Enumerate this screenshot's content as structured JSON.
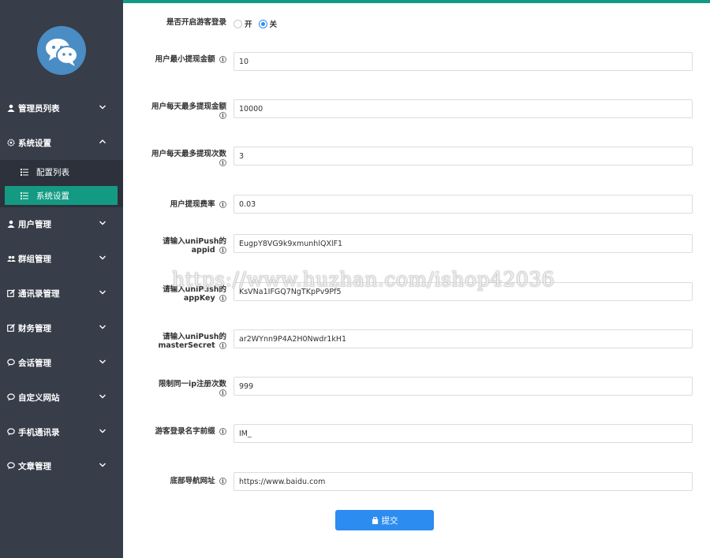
{
  "sidebar": {
    "items": [
      {
        "label": "管理员列表",
        "icon": "user-icon"
      },
      {
        "label": "系统设置",
        "icon": "gear-icon"
      },
      {
        "label": "用户管理",
        "icon": "user-icon"
      },
      {
        "label": "群组管理",
        "icon": "group-icon"
      },
      {
        "label": "通讯录管理",
        "icon": "edit-icon"
      },
      {
        "label": "财务管理",
        "icon": "edit-icon"
      },
      {
        "label": "会话管理",
        "icon": "chat-icon"
      },
      {
        "label": "自定义网站",
        "icon": "chat-icon"
      },
      {
        "label": "手机通讯录",
        "icon": "chat-icon"
      },
      {
        "label": "文章管理",
        "icon": "chat-icon"
      }
    ],
    "sub_items": [
      {
        "label": "配置列表",
        "icon": "list-icon"
      },
      {
        "label": "系统设置",
        "icon": "list-icon"
      }
    ]
  },
  "form": {
    "guest_login": {
      "label": "是否开启游客登录",
      "options": [
        "开",
        "关"
      ],
      "selected": "关"
    },
    "fields": [
      {
        "label": "用户最小提现金额",
        "value": "10"
      },
      {
        "label": "用户每天最多提现金额",
        "value": "10000"
      },
      {
        "label": "用户每天最多提现次数",
        "value": "3"
      },
      {
        "label": "用户提现费率",
        "value": "0.03"
      },
      {
        "label": "请输入uniPush的appid",
        "value": "EugpY8VG9k9xmunhlQXlF1"
      },
      {
        "label": "请输入uniPush的appKey",
        "value": "KsVNa1IFGQ7NgTKpPv9Pf5"
      },
      {
        "label": "请输入uniPush的masterSecret",
        "value": "ar2WYnn9P4A2H0Nwdr1kH1"
      },
      {
        "label": "限制同一ip注册次数",
        "value": "999"
      },
      {
        "label": "游客登录名字前缀",
        "value": "IM_"
      },
      {
        "label": "底部导航网址",
        "value": "https://www.baidu.com"
      }
    ],
    "submit_label": "提交"
  },
  "watermark": "https://www.huzhan.com/ishop42036",
  "colors": {
    "sidebar": "#373d49",
    "active": "#149a82",
    "primary": "#2d8cf0"
  }
}
